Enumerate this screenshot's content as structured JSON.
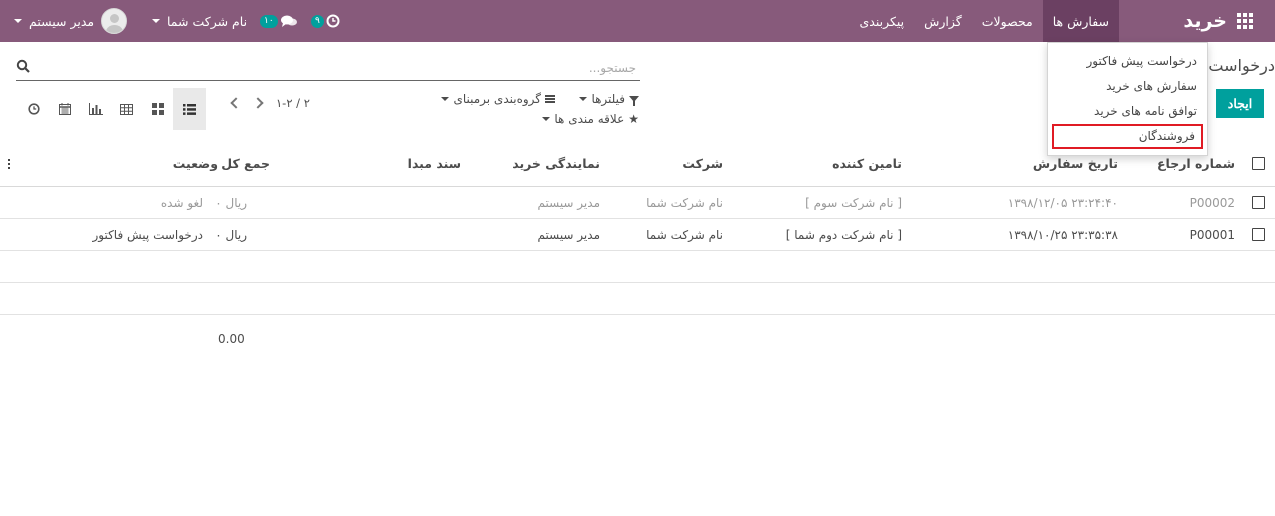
{
  "navbar": {
    "brand": "خرید",
    "menu": [
      {
        "label": "سفارش ها",
        "active": true
      },
      {
        "label": "محصولات",
        "active": false
      },
      {
        "label": "گزارش",
        "active": false
      },
      {
        "label": "پیکربندی",
        "active": false
      }
    ],
    "user_name": "مدیر سیستم",
    "company": "نام شرکت شما",
    "chat_count": "۱۰",
    "activity_count": "۹",
    "bg_color": "#875a7b"
  },
  "dropdown": {
    "items": [
      "درخواست پیش فاکتور",
      "سفارش های خرید",
      "توافق نامه های خرید",
      "فروشندگان"
    ],
    "highlighted": "فروشندگان"
  },
  "control": {
    "title": "درخواست",
    "create_label": "ایجاد",
    "search_placeholder": "جستجو...",
    "filters_label": "فیلترها",
    "groupby_label": "گروه‌بندی برمبنای",
    "favorites_label": "علاقه مندی ها",
    "pager": "۱-۲ / ۲"
  },
  "table": {
    "columns": [
      "شماره ارجاع",
      "تاریخ سفارش",
      "تامین کننده",
      "شرکت",
      "نمایندگی خرید",
      "سند مبدا",
      "جمع کل",
      "وضعیت"
    ],
    "rows": [
      {
        "ref": "P00002",
        "date": "۱۳۹۸/۱۲/۰۵ ۲۳:۲۴:۴۰",
        "vendor": "[ نام شرکت سوم ]",
        "company": "نام شرکت شما",
        "rep": "مدیر سیستم",
        "origin": "",
        "total": "۰ ریال",
        "status": "لغو شده",
        "cancelled": true
      },
      {
        "ref": "P00001",
        "date": "۱۳۹۸/۱۰/۲۵ ۲۳:۳۵:۳۸",
        "vendor": "[ نام شرکت دوم شما ]",
        "company": "نام شرکت شما",
        "rep": "مدیر سیستم",
        "origin": "",
        "total": "۰ ریال",
        "status": "درخواست پیش فاکتور",
        "cancelled": false
      }
    ],
    "grand_total": "0.00"
  },
  "colors": {
    "accent": "#00a09d",
    "highlight": "#e01b24"
  }
}
